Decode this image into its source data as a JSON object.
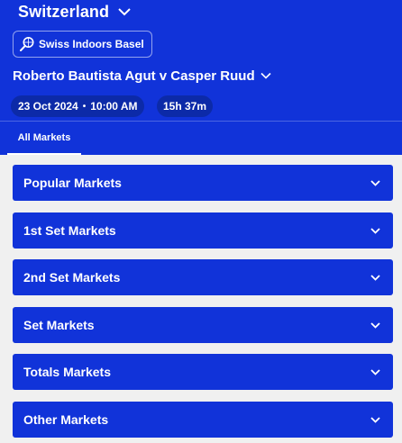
{
  "header": {
    "country": "Switzerland",
    "country_chevron_icon": "chevron-down-icon",
    "tournament": {
      "label": "Swiss Indoors Basel",
      "icon": "tennis-racket-icon"
    },
    "match_title": "Roberto Bautista Agut v Casper Ruud",
    "match_chevron_icon": "chevron-down-icon",
    "date": "23 Oct 2024",
    "time": "10:00 AM",
    "countdown": "15h 37m"
  },
  "tabs": [
    {
      "label": "All Markets",
      "active": true
    }
  ],
  "markets": [
    {
      "label": "Popular Markets"
    },
    {
      "label": "1st Set Markets"
    },
    {
      "label": "2nd Set Markets"
    },
    {
      "label": "Set Markets"
    },
    {
      "label": "Totals Markets"
    },
    {
      "label": "Other Markets"
    }
  ],
  "colors": {
    "brand_blue": "#1133d9",
    "pill_blue": "#0c2aa8",
    "page_bg": "#f0f0f0"
  }
}
